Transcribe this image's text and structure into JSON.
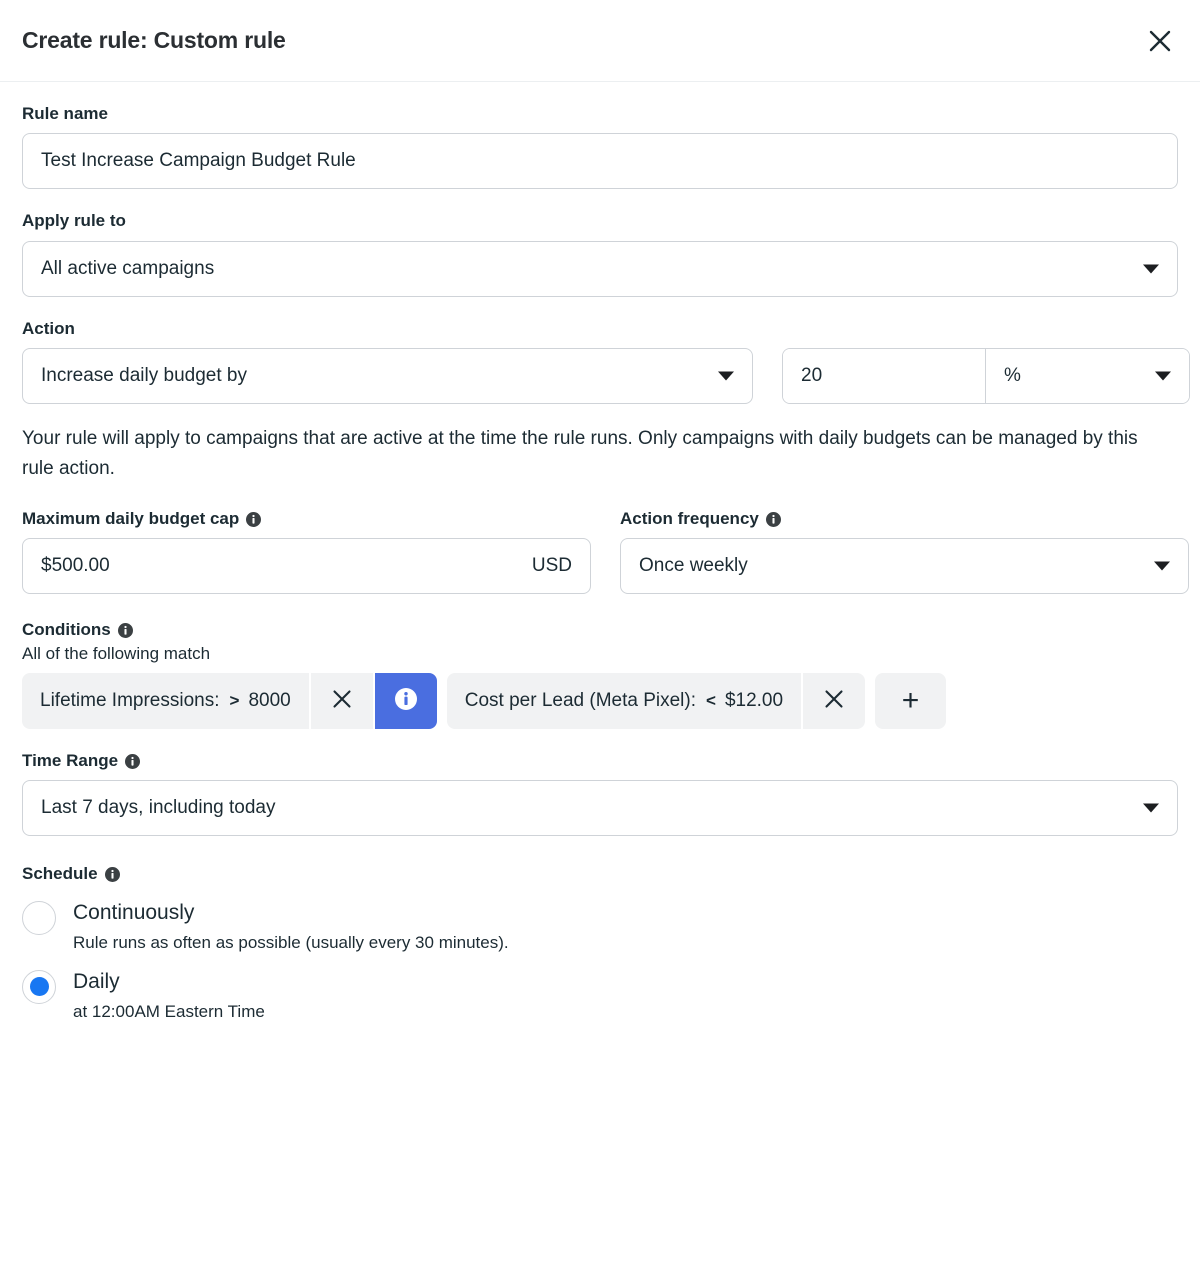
{
  "header": {
    "title": "Create rule: Custom rule",
    "close_label": "Close",
    "close_icon": "close-icon"
  },
  "rule_name": {
    "label": "Rule name",
    "value": "Test Increase Campaign Budget Rule",
    "placeholder": "Rule name"
  },
  "apply_rule_to": {
    "label": "Apply rule to",
    "value": "All active campaigns",
    "caret_icon": "chevron-down-icon"
  },
  "action": {
    "label": "Action",
    "type_value": "Increase daily budget by",
    "amount_value": "20",
    "unit_value": "%",
    "caret_icon": "chevron-down-icon"
  },
  "helper_text": "Your rule will apply to campaigns that are active at the time the rule runs. Only campaigns with daily budgets can be managed by this rule action.",
  "budget_cap": {
    "label": "Maximum daily budget cap",
    "info_icon": "info-icon",
    "value": "$500.00",
    "currency": "USD"
  },
  "action_frequency": {
    "label": "Action frequency",
    "info_icon": "info-icon",
    "value": "Once weekly",
    "caret_icon": "chevron-down-icon"
  },
  "conditions": {
    "label": "Conditions",
    "info_icon": "info-icon",
    "subtitle": "All of the following match",
    "add_label": "+",
    "remove_icon": "close-icon",
    "info_chip_icon": "info-icon",
    "accent_color": "#4a6ee0",
    "items": [
      {
        "metric": "Lifetime Impressions:",
        "operator": ">",
        "value": "8000",
        "has_info": true
      },
      {
        "metric": "Cost per Lead (Meta Pixel):",
        "operator": "<",
        "value": "$12.00",
        "has_info": false
      }
    ]
  },
  "time_range": {
    "label": "Time Range",
    "info_icon": "info-icon",
    "value": "Last 7 days, including today",
    "caret_icon": "chevron-down-icon"
  },
  "schedule": {
    "label": "Schedule",
    "info_icon": "info-icon",
    "selected_color": "#1877f2",
    "options": [
      {
        "title": "Continuously",
        "subtitle": "Rule runs as often as possible (usually every 30 minutes).",
        "selected": false
      },
      {
        "title": "Daily",
        "subtitle": "at 12:00AM Eastern Time",
        "selected": true
      }
    ]
  }
}
